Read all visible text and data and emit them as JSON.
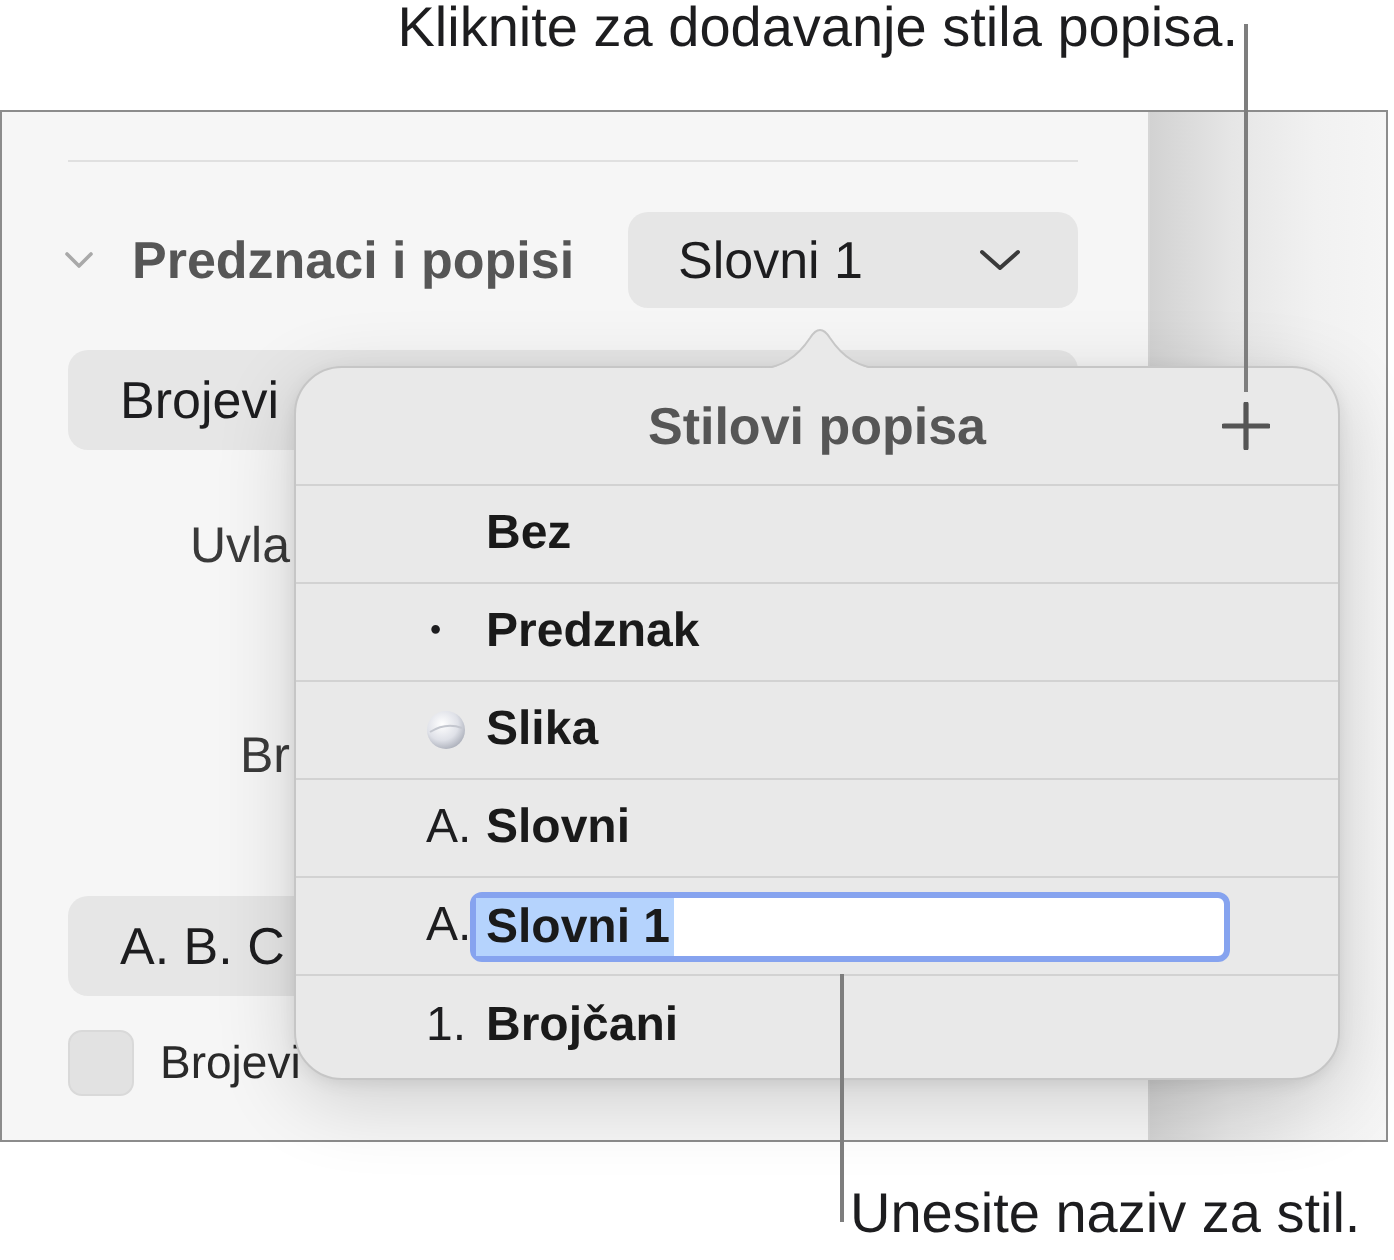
{
  "callouts": {
    "top": "Kliknite za dodavanje stila popisa.",
    "bottom": "Unesite naziv za stil."
  },
  "sidebar": {
    "section": {
      "title": "Predznaci i popisi",
      "expanded": true,
      "style_popup": "Slovni 1"
    },
    "controls": [
      {
        "kind": "popup",
        "value": "Brojevi"
      },
      {
        "kind": "label",
        "text": "Uvla"
      },
      {
        "kind": "label",
        "text": "Br"
      },
      {
        "kind": "popup",
        "value": "A. B. C"
      },
      {
        "kind": "checkbox",
        "label": "Brojevi",
        "checked": false
      }
    ]
  },
  "popover": {
    "title": "Stilovi popisa",
    "items": [
      {
        "kind": "none",
        "label": "Bez",
        "editing": false
      },
      {
        "kind": "bullet",
        "marker": "•",
        "label": "Predznak",
        "editing": false
      },
      {
        "kind": "image",
        "label": "Slika",
        "editing": false
      },
      {
        "kind": "text",
        "marker": "A.",
        "label": "Slovni",
        "editing": false
      },
      {
        "kind": "text",
        "marker": "A.",
        "label": "Slovni 1",
        "editing": true
      },
      {
        "kind": "text",
        "marker": "1.",
        "label": "Brojčani",
        "editing": false
      }
    ]
  }
}
